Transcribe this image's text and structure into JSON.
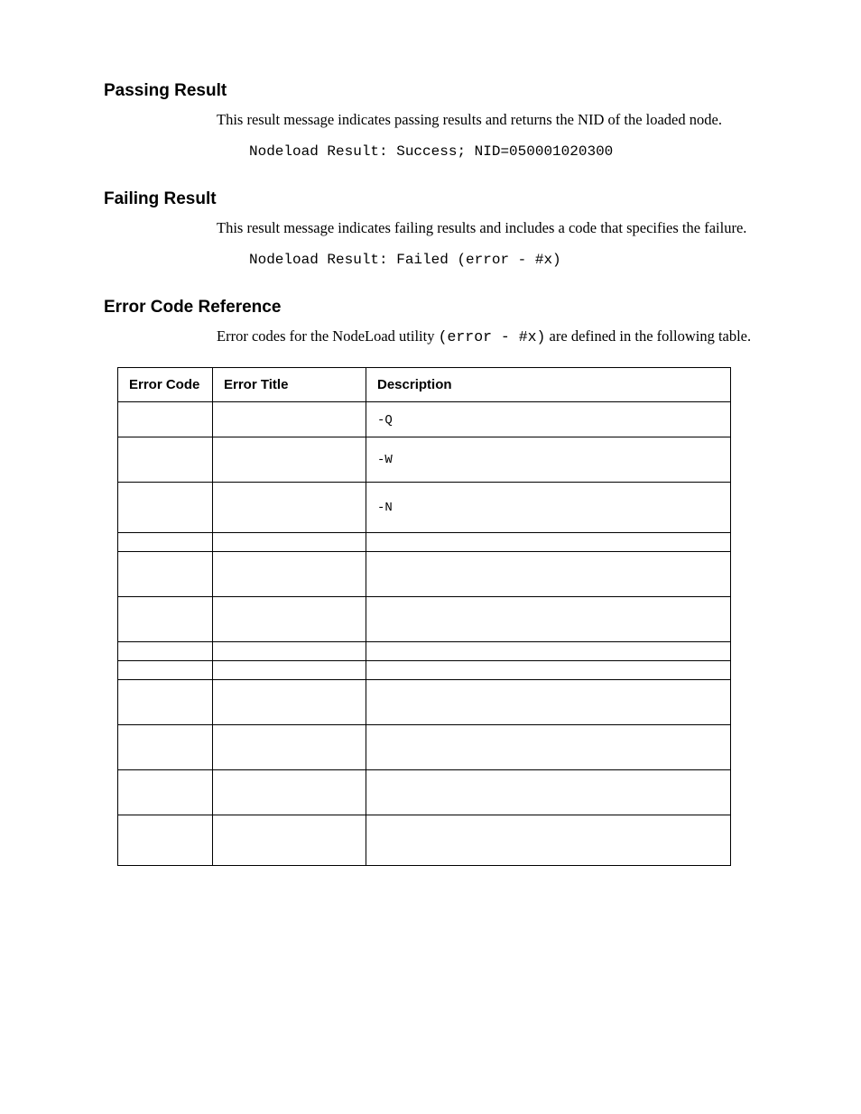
{
  "sections": {
    "passing": {
      "heading": "Passing Result",
      "body": "This result message indicates passing results and returns the NID of the loaded node.",
      "code": "Nodeload Result: Success; NID=050001020300"
    },
    "failing": {
      "heading": "Failing Result",
      "body": "This result message indicates failing results and includes a code that specifies the failure.",
      "code": "Nodeload Result: Failed (error - #x)"
    },
    "errorcodes": {
      "heading": "Error Code Reference",
      "body_pre": "Error codes for the NodeLoad utility ",
      "body_mono": "(error - #x)",
      "body_post": " are defined in the following table.",
      "table": {
        "headers": {
          "code": "Error Code",
          "title": "Error Title",
          "desc": "Description"
        },
        "rows": [
          {
            "code": "",
            "title": "",
            "desc_pre": "",
            "desc_mono": "-Q",
            "desc_post": ""
          },
          {
            "code": "",
            "title": "",
            "desc_pre": "",
            "desc_mono": "-W",
            "desc_post": ""
          },
          {
            "code": "",
            "title": "",
            "desc_pre": "",
            "desc_mono": "-N",
            "desc_post": ""
          },
          {
            "code": "",
            "title": "",
            "desc_pre": "",
            "desc_mono": "",
            "desc_post": ""
          },
          {
            "code": "",
            "title": "",
            "desc_pre": "",
            "desc_mono": "",
            "desc_post": ""
          },
          {
            "code": "",
            "title": "",
            "desc_pre": "",
            "desc_mono": "",
            "desc_post": ""
          },
          {
            "code": "",
            "title": "",
            "desc_pre": "",
            "desc_mono": "",
            "desc_post": ""
          },
          {
            "code": "",
            "title": "",
            "desc_pre": "",
            "desc_mono": "",
            "desc_post": ""
          },
          {
            "code": "",
            "title": "",
            "desc_pre": "",
            "desc_mono": "",
            "desc_post": ""
          },
          {
            "code": "",
            "title": "",
            "desc_pre": "",
            "desc_mono": "",
            "desc_post": ""
          },
          {
            "code": "",
            "title": "",
            "desc_pre": "",
            "desc_mono": "",
            "desc_post": ""
          },
          {
            "code": "",
            "title": "",
            "desc_pre": "",
            "desc_mono": "",
            "desc_post": ""
          }
        ]
      }
    }
  }
}
